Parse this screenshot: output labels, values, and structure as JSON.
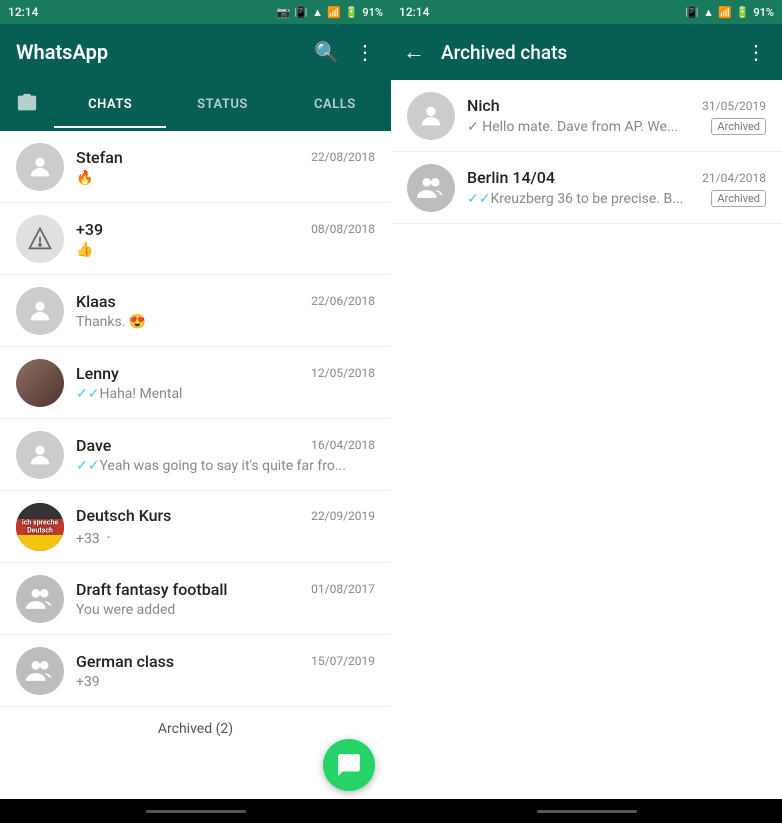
{
  "app": {
    "title": "WhatsApp",
    "archived_title": "Archived chats"
  },
  "status_bar": {
    "time": "12:14",
    "battery": "91%"
  },
  "tabs": {
    "camera_label": "📷",
    "items": [
      {
        "id": "chats",
        "label": "CHATS",
        "active": true
      },
      {
        "id": "status",
        "label": "STATUS",
        "active": false
      },
      {
        "id": "calls",
        "label": "CALLS",
        "active": false
      }
    ]
  },
  "chats": [
    {
      "id": 1,
      "name": "Stefan",
      "time": "22/08/2018",
      "preview": "🔥",
      "avatar_type": "person"
    },
    {
      "id": 2,
      "name": "+39",
      "time": "08/08/2018",
      "preview": "👍",
      "avatar_type": "triangle"
    },
    {
      "id": 3,
      "name": "Klaas",
      "time": "22/06/2018",
      "preview": "Thanks. 😍",
      "avatar_type": "person"
    },
    {
      "id": 4,
      "name": "Lenny",
      "time": "12/05/2018",
      "preview": "✓✓Haha! Mental",
      "avatar_type": "photo"
    },
    {
      "id": 5,
      "name": "Dave",
      "time": "16/04/2018",
      "preview": "✓✓Yeah was going to say it's quite far fro...",
      "avatar_type": "person"
    },
    {
      "id": 6,
      "name": "Deutsch Kurs",
      "time": "22/09/2019",
      "preview": "+33",
      "avatar_type": "deutsch",
      "has_dot": true
    },
    {
      "id": 7,
      "name": "Draft fantasy football",
      "time": "01/08/2017",
      "preview": "You were added",
      "avatar_type": "group"
    },
    {
      "id": 8,
      "name": "German class",
      "time": "15/07/2019",
      "preview": "+39",
      "avatar_type": "group"
    }
  ],
  "archived_label": "Archived (2)",
  "archived_chats": [
    {
      "id": 1,
      "name": "Nich",
      "time": "31/05/2019",
      "preview": "✓ Hello mate. Dave from AP. We...",
      "avatar_type": "person",
      "badge": "Archived"
    },
    {
      "id": 2,
      "name": "Berlin 14/04",
      "time": "21/04/2018",
      "preview": "✓✓Kreuzberg 36 to be precise. B...",
      "avatar_type": "group",
      "badge": "Archived"
    }
  ],
  "icons": {
    "search": "🔍",
    "more_vert": "⋮",
    "back_arrow": "←",
    "camera": "📷",
    "fab_chat": "💬"
  },
  "colors": {
    "primary": "#075e54",
    "accent": "#25d366",
    "status_bar": "#1a7a5e"
  }
}
